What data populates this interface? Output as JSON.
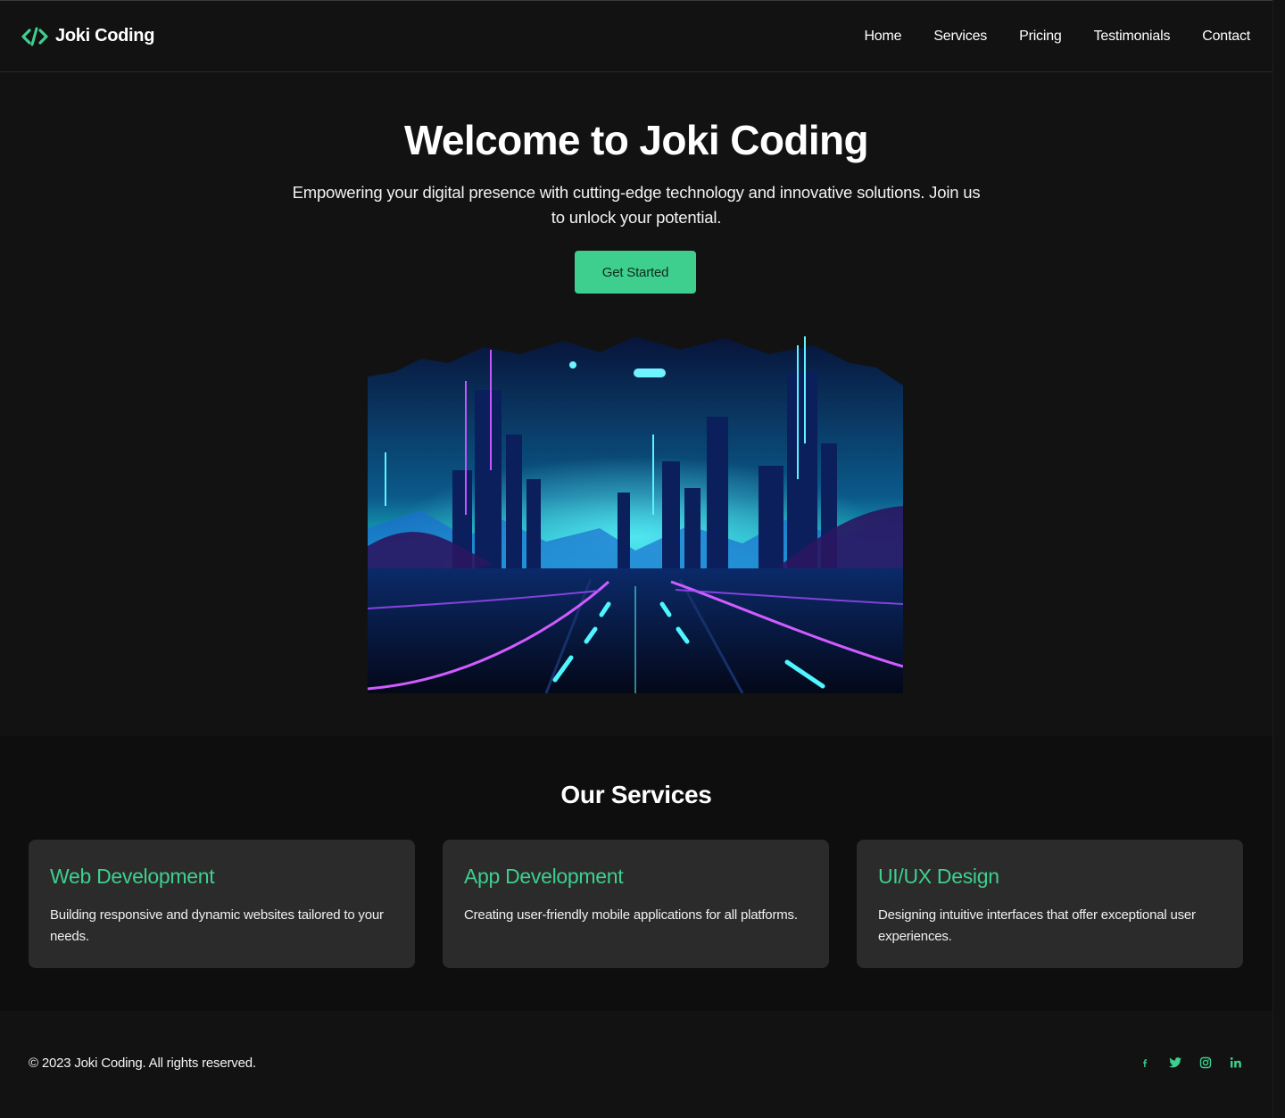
{
  "brand": {
    "name": "Joki Coding",
    "icon": "code-brackets-icon",
    "accent": "#3ecf8e"
  },
  "nav": {
    "items": [
      "Home",
      "Services",
      "Pricing",
      "Testimonials",
      "Contact"
    ]
  },
  "hero": {
    "title": "Welcome to Joki Coding",
    "subtitle": "Empowering your digital presence with cutting-edge technology and innovative solutions. Join us to unlock your potential.",
    "cta_label": "Get Started"
  },
  "services": {
    "title": "Our Services",
    "items": [
      {
        "title": "Web Development",
        "description": "Building responsive and dynamic websites tailored to your needs."
      },
      {
        "title": "App Development",
        "description": "Creating user-friendly mobile applications for all platforms."
      },
      {
        "title": "UI/UX Design",
        "description": "Designing intuitive interfaces that offer exceptional user experiences."
      }
    ]
  },
  "footer": {
    "copyright": "© 2023 Joki Coding. All rights reserved.",
    "social": [
      "facebook-icon",
      "twitter-icon",
      "instagram-icon",
      "linkedin-icon"
    ]
  },
  "colors": {
    "background": "#121212",
    "card": "#2b2b2b",
    "accent": "#3ecf8e"
  }
}
